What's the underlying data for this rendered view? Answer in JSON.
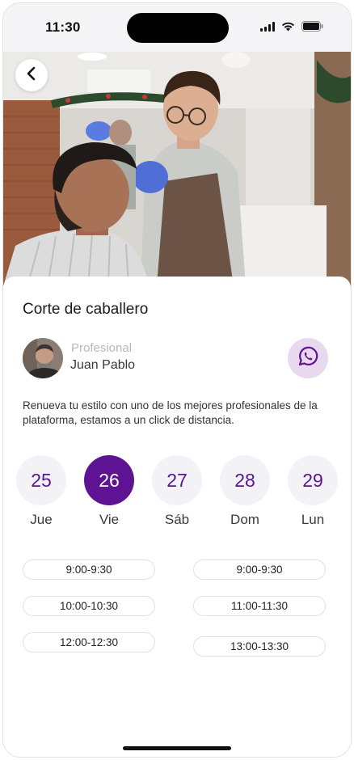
{
  "status_bar": {
    "time": "11:30",
    "icons": [
      "cellular-signal-icon",
      "wifi-icon",
      "battery-icon"
    ]
  },
  "hero": {
    "image_semantic": "barber-cutting-hair-photo",
    "back_icon": "chevron-left-icon"
  },
  "service": {
    "title": "Corte de caballero"
  },
  "professional": {
    "label": "Profesional",
    "name": "Juan Pablo",
    "contact_icon": "whatsapp-icon"
  },
  "description": "Renueva tu estilo con uno de los mejores profesionales de la plataforma, estamos a un click de distancia.",
  "dates": [
    {
      "number": "25",
      "day": "Jue",
      "selected": false
    },
    {
      "number": "26",
      "day": "Vie",
      "selected": true
    },
    {
      "number": "27",
      "day": "Sáb",
      "selected": false
    },
    {
      "number": "28",
      "day": "Dom",
      "selected": false
    },
    {
      "number": "29",
      "day": "Lun",
      "selected": false
    }
  ],
  "time_slots": {
    "left": [
      "9:00-9:30",
      "10:00-10:30",
      "12:00-12:30"
    ],
    "right": [
      "9:00-9:30",
      "11:00-11:30",
      "13:00-13:30"
    ]
  },
  "colors": {
    "accent": "#5e1392",
    "accent_text": "#5a1691",
    "date_bg": "#f3f2f6",
    "whatsapp_bg": "#e9d9ee"
  }
}
